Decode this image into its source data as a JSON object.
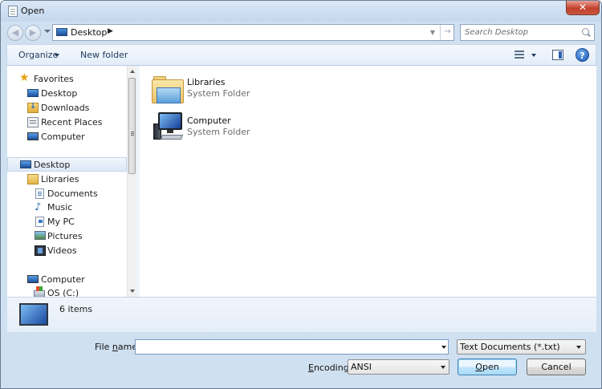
{
  "window": {
    "title": "Open",
    "close_glyph": "✕"
  },
  "address": {
    "back_glyph": "◀",
    "forward_glyph": "▶",
    "location": "Desktop",
    "chevron": "▶",
    "dropdown_glyph": "▼",
    "refresh_glyph": "→",
    "search_placeholder": "Search Desktop"
  },
  "toolbar": {
    "organize_label": "Organize",
    "new_folder_label": "New folder",
    "help_glyph": "?"
  },
  "nav": {
    "favorites_label": "Favorites",
    "favorites": [
      {
        "label": "Desktop",
        "icon": "desktop-icon"
      },
      {
        "label": "Downloads",
        "icon": "downloads-icon"
      },
      {
        "label": "Recent Places",
        "icon": "recent-places-icon"
      },
      {
        "label": "Computer",
        "icon": "computer-icon"
      }
    ],
    "desktop_label": "Desktop",
    "libraries_label": "Libraries",
    "libraries": [
      {
        "label": "Documents",
        "icon": "documents-icon"
      },
      {
        "label": "Music",
        "icon": "music-icon"
      },
      {
        "label": "My PC",
        "icon": "my-pc-icon"
      },
      {
        "label": "Pictures",
        "icon": "pictures-icon"
      },
      {
        "label": "Videos",
        "icon": "videos-icon"
      }
    ],
    "computer_label": "Computer",
    "drive_label": "OS (C:)"
  },
  "content": {
    "items": [
      {
        "name": "Libraries",
        "type": "System Folder",
        "icon": "libraries-folder-icon"
      },
      {
        "name": "Computer",
        "type": "System Folder",
        "icon": "computer-icon"
      }
    ]
  },
  "details": {
    "count_text": "6 items"
  },
  "footer": {
    "file_name_label_pre": "File ",
    "file_name_label_u": "n",
    "file_name_label_post": "ame:",
    "file_name_value": "",
    "file_type_value": "Text Documents (*.txt)",
    "encoding_label_pre": "",
    "encoding_label_u": "E",
    "encoding_label_post": "ncoding:",
    "encoding_value": "ANSI",
    "open_label_u": "O",
    "open_label_post": "pen",
    "cancel_label": "Cancel"
  },
  "colors": {
    "frame": "#cfe0f1",
    "selection": "#dce8f6",
    "close_red": "#c2402b",
    "default_button": "#bee6fd"
  }
}
